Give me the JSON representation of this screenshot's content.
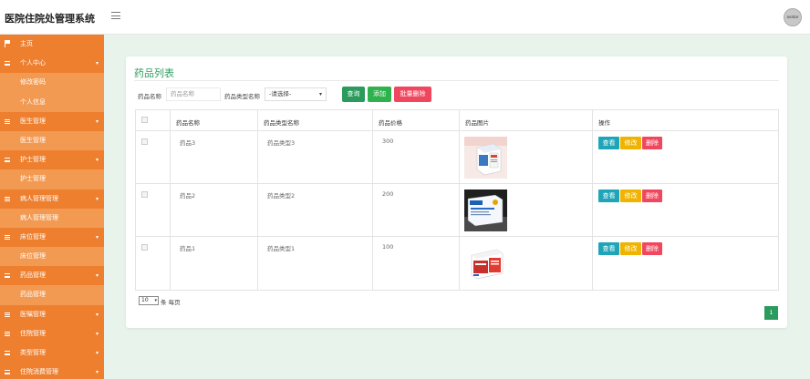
{
  "app": {
    "title": "医院住院处管理系统",
    "avatar_text": "avatar"
  },
  "sidebar": {
    "items": [
      {
        "label": "主页",
        "type": "home",
        "icon": "flag-icon"
      },
      {
        "label": "个人中心",
        "type": "group",
        "icon": "list-icon"
      },
      {
        "label": "修改密码",
        "type": "sub"
      },
      {
        "label": "个人信息",
        "type": "sub"
      },
      {
        "label": "医生管理",
        "type": "group",
        "icon": "list-icon"
      },
      {
        "label": "医生管理",
        "type": "sub"
      },
      {
        "label": "护士管理",
        "type": "group",
        "icon": "list-icon"
      },
      {
        "label": "护士管理",
        "type": "sub"
      },
      {
        "label": "病人管理管理",
        "type": "group",
        "icon": "list-icon"
      },
      {
        "label": "病人管理管理",
        "type": "sub"
      },
      {
        "label": "床位管理",
        "type": "group",
        "icon": "list-icon"
      },
      {
        "label": "床位管理",
        "type": "sub"
      },
      {
        "label": "药品管理",
        "type": "group",
        "icon": "list-icon"
      },
      {
        "label": "药品管理",
        "type": "sub"
      },
      {
        "label": "医嘱管理",
        "type": "group",
        "icon": "list-icon"
      },
      {
        "label": "住院管理",
        "type": "group",
        "icon": "list-icon"
      },
      {
        "label": "类型管理",
        "type": "group",
        "icon": "list-icon"
      },
      {
        "label": "住院消费管理",
        "type": "group",
        "icon": "list-icon"
      }
    ]
  },
  "page": {
    "title": "药品列表"
  },
  "filters": {
    "name_label": "药品名称",
    "name_placeholder": "药品名称",
    "type_label": "药品类型名称",
    "type_selected": "-请选择-",
    "search_btn": "查询",
    "add_btn": "添加",
    "batch_delete_btn": "批量删除"
  },
  "table": {
    "headers": [
      "药品名称",
      "药品类型名称",
      "药品价格",
      "药品图片",
      "操作"
    ],
    "rows": [
      {
        "name": "药品3",
        "type": "药品类型3",
        "price": "300"
      },
      {
        "name": "药品2",
        "type": "药品类型2",
        "price": "200"
      },
      {
        "name": "药品1",
        "type": "药品类型1",
        "price": "100"
      }
    ],
    "actions": {
      "view": "查看",
      "edit": "修改",
      "delete": "删除"
    }
  },
  "pagination": {
    "page_size": "10",
    "page_size_suffix": "条 每页",
    "current_page": "1"
  },
  "colors": {
    "sidebar": "#f08a3c",
    "primary_green": "#2a9b5c",
    "view_btn": "#1fa5b8",
    "edit_btn": "#f0b400",
    "delete_btn": "#f0475e"
  }
}
